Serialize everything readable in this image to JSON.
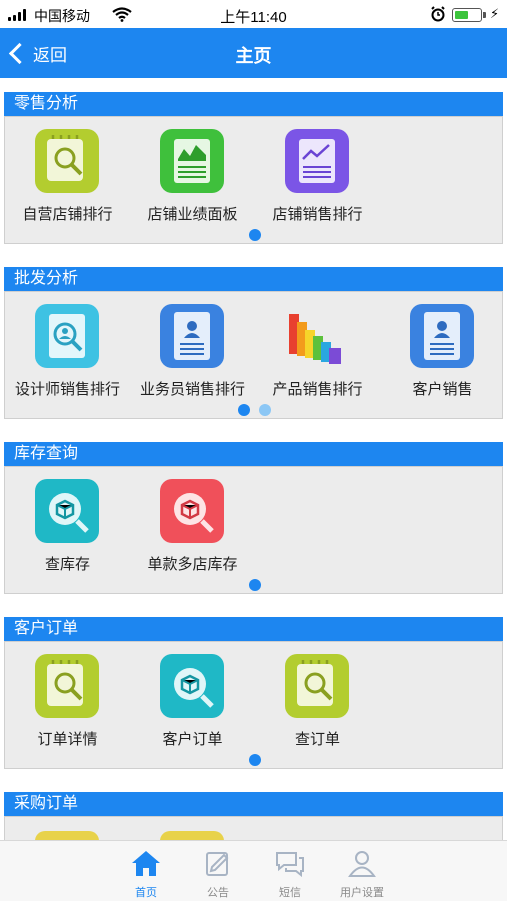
{
  "status_bar": {
    "carrier": "中国移动",
    "time": "上午11:40"
  },
  "nav": {
    "back_label": "返回",
    "title": "主页"
  },
  "sections": [
    {
      "title": "零售分析",
      "items": [
        {
          "label": "自营店铺排行",
          "icon": "store-rank-icon"
        },
        {
          "label": "店铺业绩面板",
          "icon": "performance-board-icon"
        },
        {
          "label": "店铺销售排行",
          "icon": "sales-rank-icon"
        }
      ]
    },
    {
      "title": "批发分析",
      "items": [
        {
          "label": "设计师销售排行",
          "icon": "designer-rank-icon"
        },
        {
          "label": "业务员销售排行",
          "icon": "salesman-rank-icon"
        },
        {
          "label": "产品销售排行",
          "icon": "product-rank-icon"
        },
        {
          "label": "客户销售",
          "icon": "customer-sales-icon"
        }
      ]
    },
    {
      "title": "库存查询",
      "items": [
        {
          "label": "查库存",
          "icon": "stock-query-icon"
        },
        {
          "label": "单款多店库存",
          "icon": "multi-store-stock-icon"
        }
      ]
    },
    {
      "title": "客户订单",
      "items": [
        {
          "label": "订单详情",
          "icon": "order-detail-icon"
        },
        {
          "label": "客户订单",
          "icon": "customer-order-icon"
        },
        {
          "label": "查订单",
          "icon": "order-query-icon"
        }
      ]
    },
    {
      "title": "采购订单",
      "items": []
    }
  ],
  "tabs": [
    {
      "label": "首页",
      "icon": "home-icon",
      "active": true
    },
    {
      "label": "公告",
      "icon": "notice-icon",
      "active": false
    },
    {
      "label": "短信",
      "icon": "message-icon",
      "active": false
    },
    {
      "label": "用户设置",
      "icon": "user-settings-icon",
      "active": false
    }
  ],
  "colors": {
    "primary": "#1d86f0",
    "tab_inactive": "#8a8a8a"
  }
}
